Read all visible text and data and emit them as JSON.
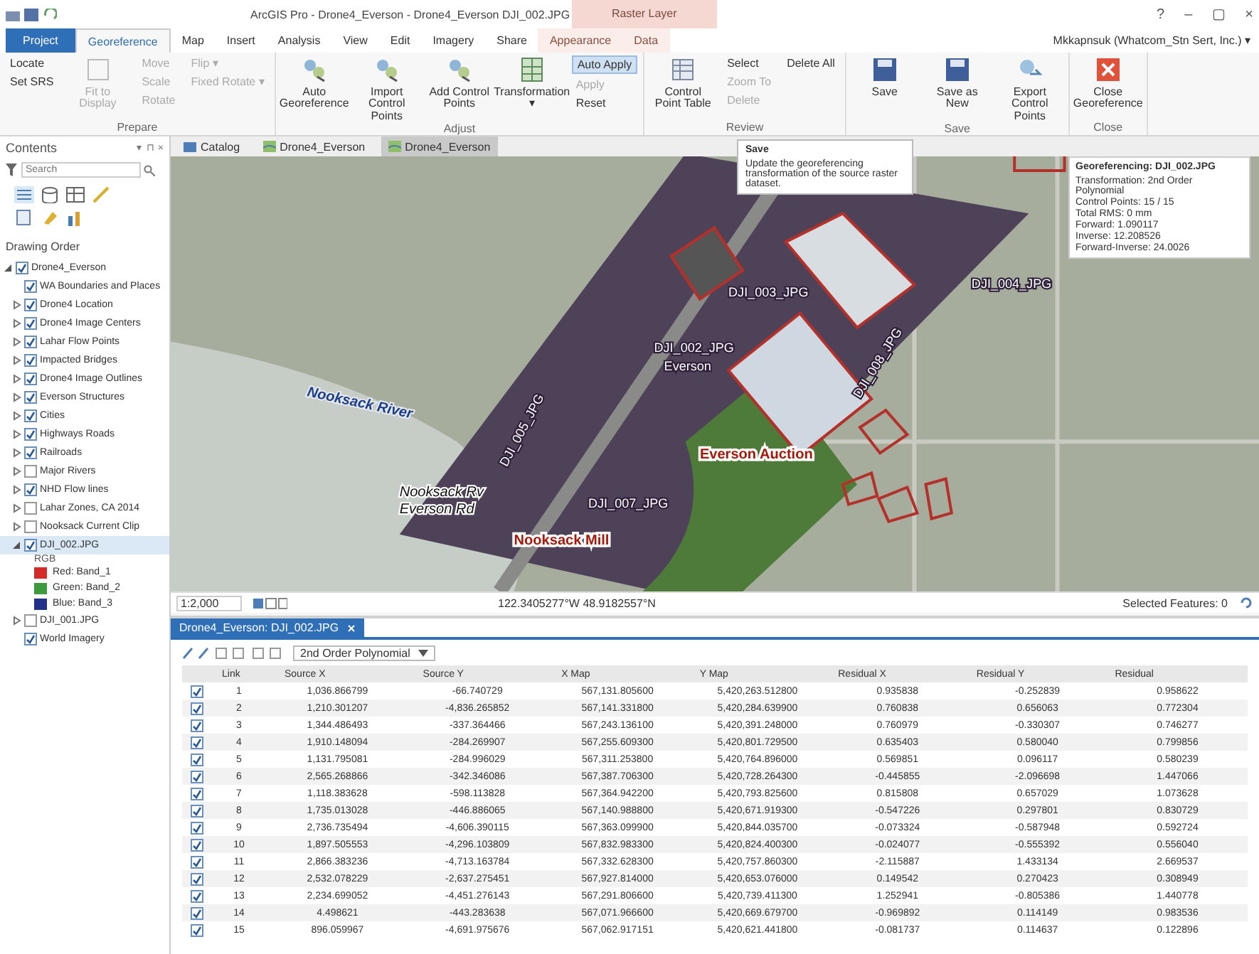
{
  "window": {
    "title": "ArcGIS Pro - Drone4_Everson - Drone4_Everson DJI_002.JPG",
    "context_tab": "Raster Layer",
    "controls": [
      "?",
      "–",
      "▢",
      "×"
    ]
  },
  "tabs": [
    {
      "label": "Project",
      "kind": "backstage",
      "selected": false
    },
    {
      "label": "Georeference",
      "kind": "tab",
      "selected": true
    },
    {
      "label": "Map",
      "kind": "tab",
      "selected": false
    },
    {
      "label": "Insert",
      "kind": "tab",
      "selected": false
    },
    {
      "label": "Analysis",
      "kind": "tab",
      "selected": false
    },
    {
      "label": "View",
      "kind": "tab",
      "selected": false
    },
    {
      "label": "Edit",
      "kind": "tab",
      "selected": false
    },
    {
      "label": "Imagery",
      "kind": "tab",
      "selected": false
    },
    {
      "label": "Share",
      "kind": "tab",
      "selected": false
    },
    {
      "label": "Appearance",
      "kind": "context",
      "selected": false
    },
    {
      "label": "Data",
      "kind": "context",
      "selected": false
    }
  ],
  "user": "Mkkapnsuk (Whatcom_Stn Sert, Inc.) ▾",
  "ribbon": [
    {
      "label": "Prepare",
      "controls": [
        {
          "kind": "stack",
          "items": [
            {
              "label": "Locate",
              "disabled": false
            },
            {
              "label": "Set SRS",
              "disabled": false
            }
          ]
        },
        {
          "kind": "large",
          "label": "Fit to Display",
          "disabled": true
        },
        {
          "kind": "stack",
          "items": [
            {
              "label": "Move",
              "disabled": true
            },
            {
              "label": "Scale",
              "disabled": true
            },
            {
              "label": "Rotate",
              "disabled": true
            }
          ]
        },
        {
          "kind": "stack",
          "items": [
            {
              "label": "Flip ▾",
              "disabled": true
            },
            {
              "label": "Fixed Rotate ▾",
              "disabled": true
            }
          ]
        }
      ]
    },
    {
      "label": "Adjust",
      "controls": [
        {
          "kind": "large",
          "label": "Auto Georeference",
          "disabled": false
        },
        {
          "kind": "large",
          "label": "Import Control Points",
          "disabled": false
        },
        {
          "kind": "large",
          "label": "Add Control Points",
          "disabled": false
        },
        {
          "kind": "large",
          "label": "Transformation ▾",
          "disabled": false
        },
        {
          "kind": "stack",
          "items": [
            {
              "label": "Auto Apply",
              "disabled": false,
              "on": true
            },
            {
              "label": "Apply",
              "disabled": true
            },
            {
              "label": "Reset",
              "disabled": false
            }
          ]
        }
      ]
    },
    {
      "label": "Review",
      "controls": [
        {
          "kind": "large",
          "label": "Control Point Table",
          "disabled": false
        },
        {
          "kind": "stack",
          "items": [
            {
              "label": "Select",
              "disabled": false
            },
            {
              "label": "Zoom To",
              "disabled": true
            },
            {
              "label": "Delete",
              "disabled": true
            }
          ]
        },
        {
          "kind": "stack",
          "items": [
            {
              "label": "Delete All",
              "disabled": false
            }
          ]
        }
      ]
    },
    {
      "label": "Save",
      "controls": [
        {
          "kind": "large",
          "label": "Save",
          "disabled": false
        },
        {
          "kind": "large",
          "label": "Save as New",
          "disabled": false
        },
        {
          "kind": "large",
          "label": "Export Control Points",
          "disabled": false
        }
      ]
    },
    {
      "label": "Close",
      "controls": [
        {
          "kind": "large",
          "label": "Close Georeference",
          "disabled": false
        }
      ]
    }
  ],
  "contents": {
    "title": "Contents",
    "pane_controls": [
      "▾",
      "⊓",
      "×"
    ],
    "search": {
      "placeholder": "Search"
    },
    "heading": "Drawing Order",
    "layers": [
      {
        "name": "Drone4_Everson",
        "checked": true,
        "expanded": true,
        "children": [
          {
            "name": "WA Boundaries and Places",
            "checked": true
          },
          {
            "name": "Drone4 Location",
            "checked": true,
            "expanded": false
          },
          {
            "name": "Drone4 Image Centers",
            "checked": true,
            "expanded": false
          },
          {
            "name": "Lahar Flow Points",
            "checked": true,
            "expanded": false
          },
          {
            "name": "Impacted Bridges",
            "checked": true,
            "expanded": false
          },
          {
            "name": "Drone4 Image Outlines",
            "checked": true,
            "expanded": false
          },
          {
            "name": "Everson Structures",
            "checked": true,
            "expanded": false
          },
          {
            "name": "Cities",
            "checked": true,
            "expanded": false
          },
          {
            "name": "Highways Roads",
            "checked": true,
            "expanded": false
          },
          {
            "name": "Railroads",
            "checked": true,
            "expanded": false
          },
          {
            "name": "Major Rivers",
            "checked": false,
            "expanded": false
          },
          {
            "name": "NHD Flow lines",
            "checked": true,
            "expanded": false
          },
          {
            "name": "Lahar Zones, CA 2014",
            "checked": false,
            "expanded": false
          },
          {
            "name": "Nooksack Current Clip",
            "checked": false,
            "expanded": false
          },
          {
            "name": "DJI_002.JPG",
            "checked": true,
            "expanded": true,
            "selected": true,
            "legend_title": "RGB",
            "legend": [
              {
                "label": "Red: Band_1",
                "color": "#d42a2a"
              },
              {
                "label": "Green: Band_2",
                "color": "#3e9a3e"
              },
              {
                "label": "Blue: Band_3",
                "color": "#23308a"
              }
            ]
          },
          {
            "name": "DJI_001.JPG",
            "checked": false,
            "expanded": false
          },
          {
            "name": "World Imagery",
            "checked": true
          }
        ]
      }
    ]
  },
  "views": [
    {
      "label": "Catalog",
      "kind": "catalog",
      "selected": false
    },
    {
      "label": "Drone4_Everson",
      "kind": "map",
      "selected": false
    },
    {
      "label": "Drone4_Everson",
      "kind": "map",
      "selected": true
    }
  ],
  "tooltip": {
    "title": "Save",
    "text": "Update the georeferencing transformation of the source raster dataset."
  },
  "info": {
    "title": "Georeferencing: DJI_002.JPG",
    "lines": [
      "Transformation: 2nd Order Polynomial",
      "Control Points: 15 / 15",
      "Total RMS: 0 mm",
      "Forward: 1.090117",
      "Inverse: 12.208526",
      "Forward-Inverse: 24.0026"
    ]
  },
  "map_labels": [
    {
      "text": "Nooksack River",
      "kind": "river"
    },
    {
      "text": "DJI_005_JPG",
      "kind": "point"
    },
    {
      "text": "DJI_003_JPG",
      "kind": "point"
    },
    {
      "text": "DJI_004_JPG",
      "kind": "point"
    },
    {
      "text": "DJI_002_JPG",
      "kind": "point"
    },
    {
      "text": "Everson",
      "kind": "point"
    },
    {
      "text": "DJI_008_JPG",
      "kind": "point"
    },
    {
      "text": "DJI_007_JPG",
      "kind": "point"
    },
    {
      "text": "Everson Auction",
      "kind": "poi"
    },
    {
      "text": "Nooksack Rv",
      "kind": "place"
    },
    {
      "text": "Everson Rd",
      "kind": "place"
    },
    {
      "text": "Nooksack Mill",
      "kind": "poi"
    }
  ],
  "status": {
    "scale": "1:2,000",
    "coordinates": "122.3405277°W 48.9182557°N",
    "selection": "Selected Features: 0"
  },
  "table": {
    "tab": "Drone4_Everson: DJI_002.JPG",
    "transformation": "2nd Order Polynomial",
    "columns": [
      "Link",
      "Source X",
      "Source Y",
      "X Map",
      "Y Map",
      "Residual X",
      "Residual Y",
      "Residual"
    ],
    "rows": [
      {
        "checked": true,
        "cells": [
          "1",
          "1,036.866799",
          "-66.740729",
          "567,131.805600",
          "5,420,263.512800",
          "0.935838",
          "-0.252839",
          "0.958622"
        ]
      },
      {
        "checked": true,
        "cells": [
          "2",
          "1,210.301207",
          "-4,836.265852",
          "567,141.331800",
          "5,420,284.639900",
          "0.760838",
          "0.656063",
          "0.772304"
        ]
      },
      {
        "checked": true,
        "cells": [
          "3",
          "1,344.486493",
          "-337.364466",
          "567,243.136100",
          "5,420,391.248000",
          "0.760979",
          "-0.330307",
          "0.746277"
        ]
      },
      {
        "checked": true,
        "cells": [
          "4",
          "1,910.148094",
          "-284.269907",
          "567,255.609300",
          "5,420,801.729500",
          "0.635403",
          "0.580040",
          "0.799856"
        ]
      },
      {
        "checked": true,
        "cells": [
          "5",
          "1,131.795081",
          "-284.996029",
          "567,311.253800",
          "5,420,764.896000",
          "0.569851",
          "0.096117",
          "0.580239"
        ]
      },
      {
        "checked": true,
        "cells": [
          "6",
          "2,565.268866",
          "-342.346086",
          "567,387.706300",
          "5,420,728.264300",
          "-0.445855",
          "-2.096698",
          "1.447066"
        ]
      },
      {
        "checked": true,
        "cells": [
          "7",
          "1,118.383628",
          "-598.113828",
          "567,364.942200",
          "5,420,793.825600",
          "0.815808",
          "0.657029",
          "1.073628"
        ]
      },
      {
        "checked": true,
        "cells": [
          "8",
          "1,735.013028",
          "-446.886065",
          "567,140.988800",
          "5,420,671.919300",
          "-0.547226",
          "0.297801",
          "0.830729"
        ]
      },
      {
        "checked": true,
        "cells": [
          "9",
          "2,736.735494",
          "-4,606.390115",
          "567,363.099900",
          "5,420,844.035700",
          "-0.073324",
          "-0.587948",
          "0.592724"
        ]
      },
      {
        "checked": true,
        "cells": [
          "10",
          "1,897.505553",
          "-4,296.103809",
          "567,832.983300",
          "5,420,824.400300",
          "-0.024077",
          "-0.555392",
          "0.556040"
        ]
      },
      {
        "checked": true,
        "cells": [
          "11",
          "2,866.383236",
          "-4,713.163784",
          "567,332.628300",
          "5,420,757.860300",
          "-2.115887",
          "1.433134",
          "2.669537"
        ]
      },
      {
        "checked": true,
        "cells": [
          "12",
          "2,532.078229",
          "-2,637.275451",
          "567,927.814000",
          "5,420,653.076000",
          "0.149542",
          "0.270423",
          "0.308949"
        ]
      },
      {
        "checked": true,
        "cells": [
          "13",
          "2,234.699052",
          "-4,451.276143",
          "567,291.806600",
          "5,420,739.411300",
          "1.252941",
          "-0.805386",
          "1.440778"
        ]
      },
      {
        "checked": true,
        "cells": [
          "14",
          "4.498621",
          "-443.283638",
          "567,071.966600",
          "5,420,669.679700",
          "-0.969892",
          "0.114149",
          "0.983536"
        ]
      },
      {
        "checked": true,
        "cells": [
          "15",
          "896.059967",
          "-4,691.975676",
          "567,062.917151",
          "5,420,621.441800",
          "-0.081737",
          "0.114637",
          "0.122896"
        ]
      }
    ]
  }
}
